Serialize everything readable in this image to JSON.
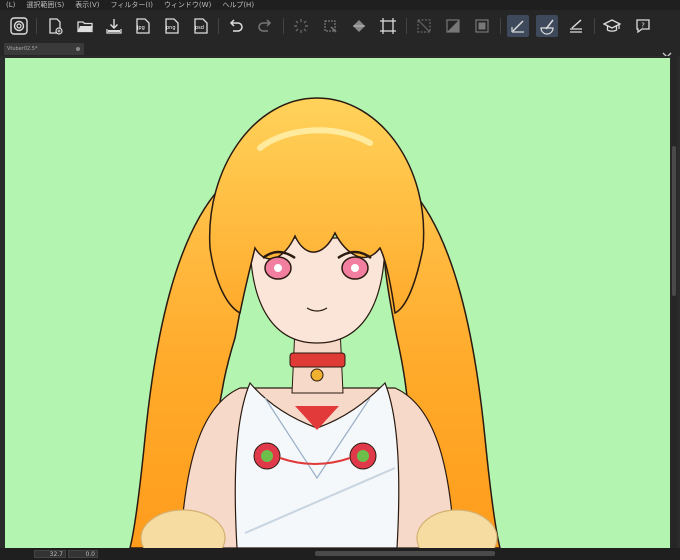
{
  "menu": {
    "items": [
      "(L)",
      "選択範囲(S)",
      "表示(V)",
      "フィルター(I)",
      "ウィンドウ(W)",
      "ヘルプ(H)"
    ]
  },
  "toolbar": {
    "icons": [
      "app-logo-icon",
      "new-file-icon",
      "open-folder-icon",
      "save-icon",
      "export-jpg-icon",
      "export-png-icon",
      "export-psd-icon",
      "undo-icon",
      "redo-icon",
      "busy-icon",
      "crop-icon",
      "fill-icon",
      "transform-icon",
      "clear-selection-icon",
      "invert-selection-icon",
      "select-all-icon",
      "snap-ruler-icon",
      "snap-special-ruler-icon",
      "snap-grid-icon",
      "learn-icon",
      "help-icon"
    ],
    "jpg_label": "jpg",
    "png_label": "png",
    "psd_label": "psd"
  },
  "document": {
    "tab_label": "Vtuber02.5*",
    "canvas_color": "#b3f5b0"
  },
  "status": {
    "zoom": "32.7",
    "rotation": "0.0"
  }
}
